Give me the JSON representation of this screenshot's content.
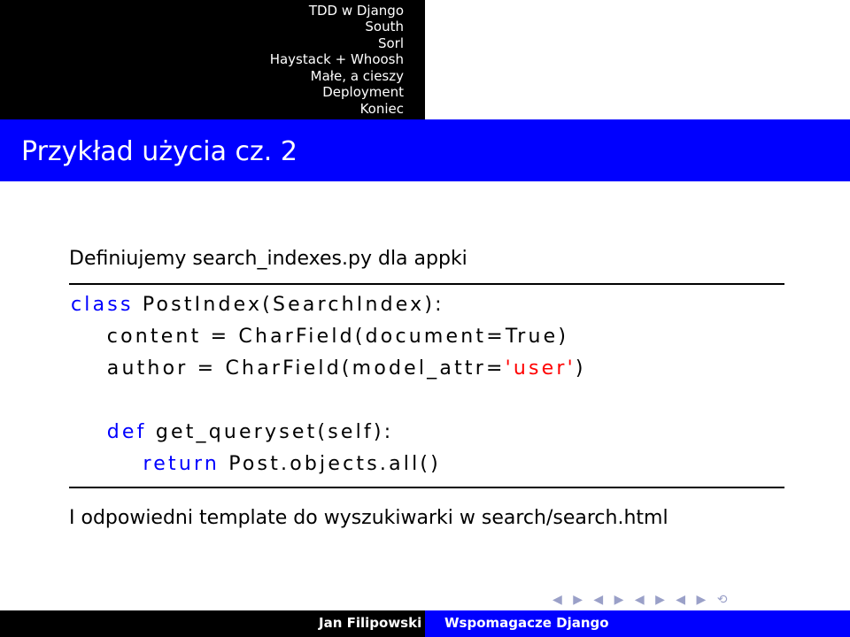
{
  "nav": {
    "items": [
      "TDD w Django",
      "South",
      "Sorl",
      "Haystack + Whoosh",
      "Małe, a cieszy",
      "Deployment",
      "Koniec"
    ]
  },
  "title": "Przykład użycia cz. 2",
  "intro": "Definiujemy search_indexes.py dla appki",
  "code": {
    "line1_kw": "class",
    "line1_rest": " PostIndex(SearchIndex):",
    "line2": "    content = CharField(document=True)",
    "line3_a": "    author = CharField(model_attr=",
    "line3_str": "'user'",
    "line3_b": ")",
    "line4_kw": "    def",
    "line4_rest": " get_queryset(self):",
    "line5_kw": "        return",
    "line5_rest": " Post.objects.all()"
  },
  "outro": "I odpowiedni template do wyszukiwarki w search/search.html",
  "footer": {
    "author": "Jan Filipowski",
    "talk": "Wspomagacze Django"
  },
  "colors": {
    "accent": "#0000ff",
    "string": "#ff0000",
    "background": "#ffffff"
  },
  "nav_icons": "◀ ▶ ◀ ▶ ◀ ▶ ◀ ▶ ⟲"
}
